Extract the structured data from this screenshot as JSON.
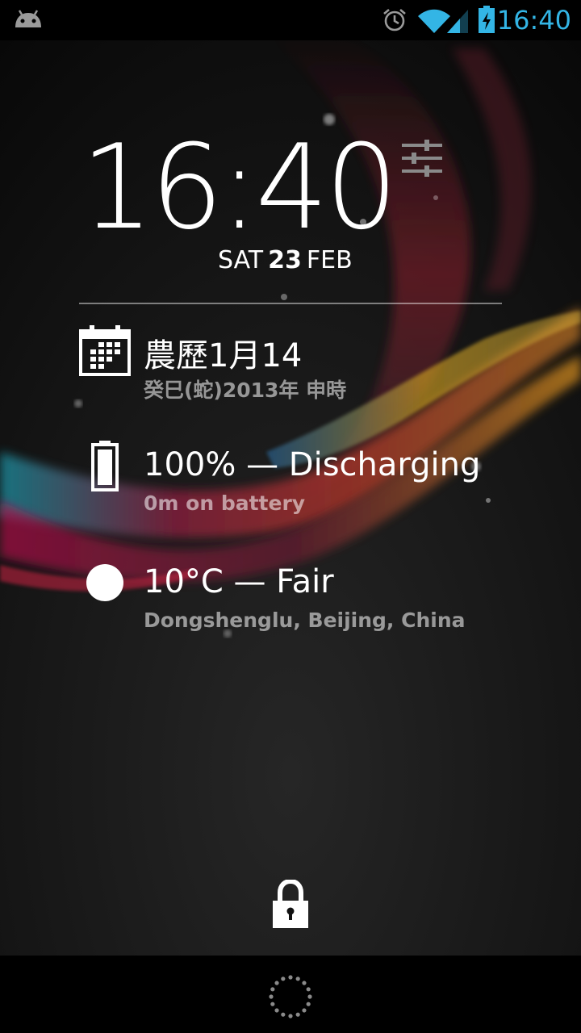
{
  "status_bar": {
    "time": "16:40",
    "icons": [
      "android-icon",
      "alarm-icon",
      "wifi-icon",
      "signal-icon",
      "battery-charging-icon"
    ],
    "accent_color": "#33b5e5"
  },
  "lockscreen": {
    "clock": "16:40",
    "date": {
      "weekday": "SAT",
      "day": "23",
      "month": "FEB"
    },
    "calendar": {
      "title": "農歷1月14",
      "subtitle": "癸巳(蛇)2013年 申時"
    },
    "battery": {
      "title": "100% — Discharging",
      "subtitle": "0m on battery",
      "level_percent": 100
    },
    "weather": {
      "title": "10°C — Fair",
      "subtitle": "Dongshenglu, Beijing, China"
    }
  },
  "icons": {
    "settings": "sliders-icon",
    "calendar": "calendar-icon",
    "battery": "battery-icon",
    "weather": "moon-icon",
    "lock": "lock-icon",
    "loading": "spinner-icon"
  }
}
